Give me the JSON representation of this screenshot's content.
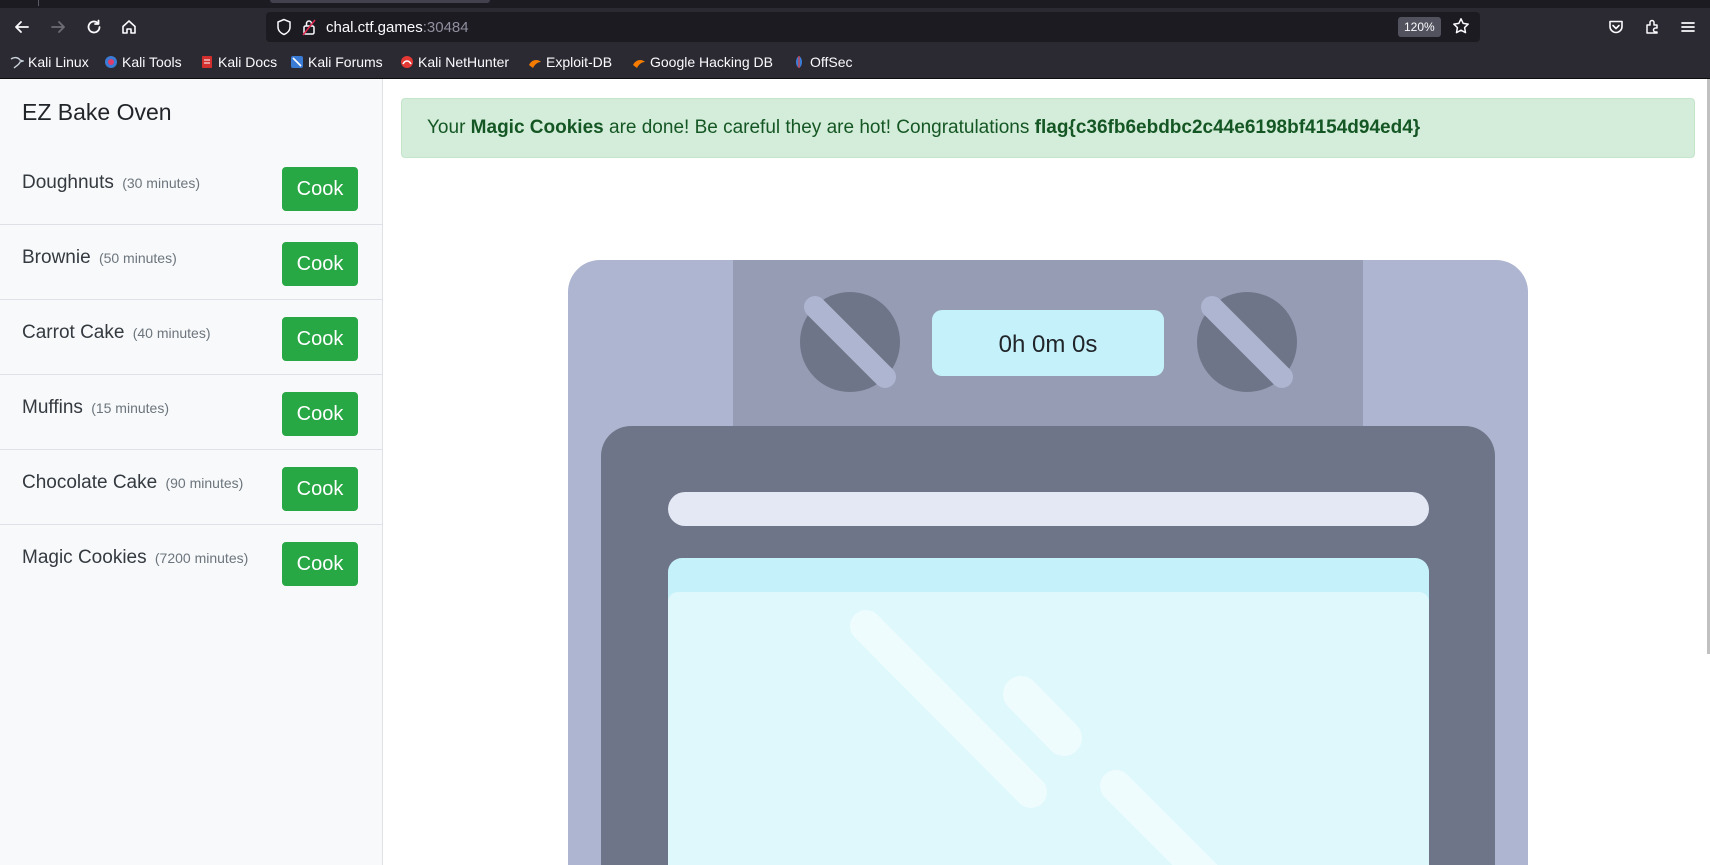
{
  "browser": {
    "url_host": "chal.ctf.games",
    "url_port": ":30484",
    "zoom": "120%",
    "bookmarks": [
      {
        "label": "Kali Linux",
        "icon": "kali-dragon-icon"
      },
      {
        "label": "Kali Tools",
        "icon": "kali-tools-icon"
      },
      {
        "label": "Kali Docs",
        "icon": "kali-docs-icon"
      },
      {
        "label": "Kali Forums",
        "icon": "kali-forums-icon"
      },
      {
        "label": "Kali NetHunter",
        "icon": "nethunter-icon"
      },
      {
        "label": "Exploit-DB",
        "icon": "exploit-db-icon"
      },
      {
        "label": "Google Hacking DB",
        "icon": "ghdb-icon"
      },
      {
        "label": "OffSec",
        "icon": "offsec-icon"
      }
    ]
  },
  "sidebar": {
    "title": "EZ Bake Oven",
    "items": [
      {
        "name": "Doughnuts",
        "time": "(30 minutes)",
        "button": "Cook"
      },
      {
        "name": "Brownie",
        "time": "(50 minutes)",
        "button": "Cook"
      },
      {
        "name": "Carrot Cake",
        "time": "(40 minutes)",
        "button": "Cook"
      },
      {
        "name": "Muffins",
        "time": "(15 minutes)",
        "button": "Cook"
      },
      {
        "name": "Chocolate Cake",
        "time": "(90 minutes)",
        "button": "Cook"
      },
      {
        "name": "Magic Cookies",
        "time": "(7200 minutes)",
        "button": "Cook"
      }
    ]
  },
  "alert": {
    "prefix": "Your ",
    "item": "Magic Cookies",
    "middle": " are done! Be careful they are hot! Congratulations ",
    "flag": "flag{c36fb6ebdbc2c44e6198bf4154d94ed4}"
  },
  "oven": {
    "timer": "0h 0m 0s"
  },
  "colors": {
    "success": "#28a745",
    "alert_bg": "#d4edda",
    "alert_text": "#155724",
    "oven_body": "#adb5d0",
    "oven_panel": "#969cb4",
    "oven_door": "#6f7588",
    "oven_window": "#dff8fc"
  }
}
